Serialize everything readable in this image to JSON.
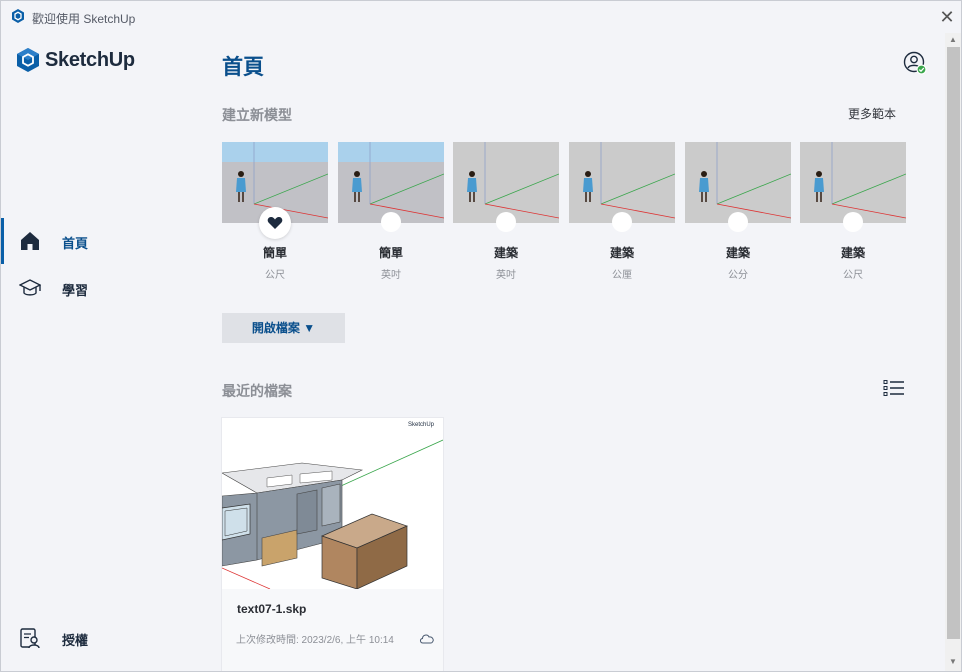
{
  "window": {
    "title": "歡迎使用 SketchUp",
    "close_symbol": "✕"
  },
  "sidebar": {
    "logo_text": "SketchUp",
    "items": [
      {
        "label": "首頁",
        "icon": "home-icon",
        "active": true
      },
      {
        "label": "學習",
        "icon": "graduation-cap-icon",
        "active": false
      }
    ],
    "bottom_item": {
      "label": "授權",
      "icon": "license-icon"
    }
  },
  "main": {
    "page_title": "首頁",
    "new_model": {
      "section_title": "建立新模型",
      "more_templates": "更多範本",
      "templates": [
        {
          "name": "簡單",
          "unit": "公尺",
          "favorite": true,
          "sky": true
        },
        {
          "name": "簡單",
          "unit": "英吋",
          "favorite": false,
          "sky": true
        },
        {
          "name": "建築",
          "unit": "英吋",
          "favorite": false,
          "sky": false
        },
        {
          "name": "建築",
          "unit": "公厘",
          "favorite": false,
          "sky": false
        },
        {
          "name": "建築",
          "unit": "公分",
          "favorite": false,
          "sky": false
        },
        {
          "name": "建築",
          "unit": "公尺",
          "favorite": false,
          "sky": false
        }
      ]
    },
    "open_file_button": "開啟檔案 ▼",
    "recent": {
      "section_title": "最近的檔案",
      "files": [
        {
          "name": "text07-1.skp",
          "modified": "上次修改時間:   2023/2/6, 上午 10:14",
          "brand": "SketchUp"
        }
      ]
    }
  },
  "colors": {
    "accent": "#0a4f8c",
    "brand_dark": "#1d2b3e",
    "background": "#f3f4f8",
    "muted_text": "#8c8f96"
  }
}
